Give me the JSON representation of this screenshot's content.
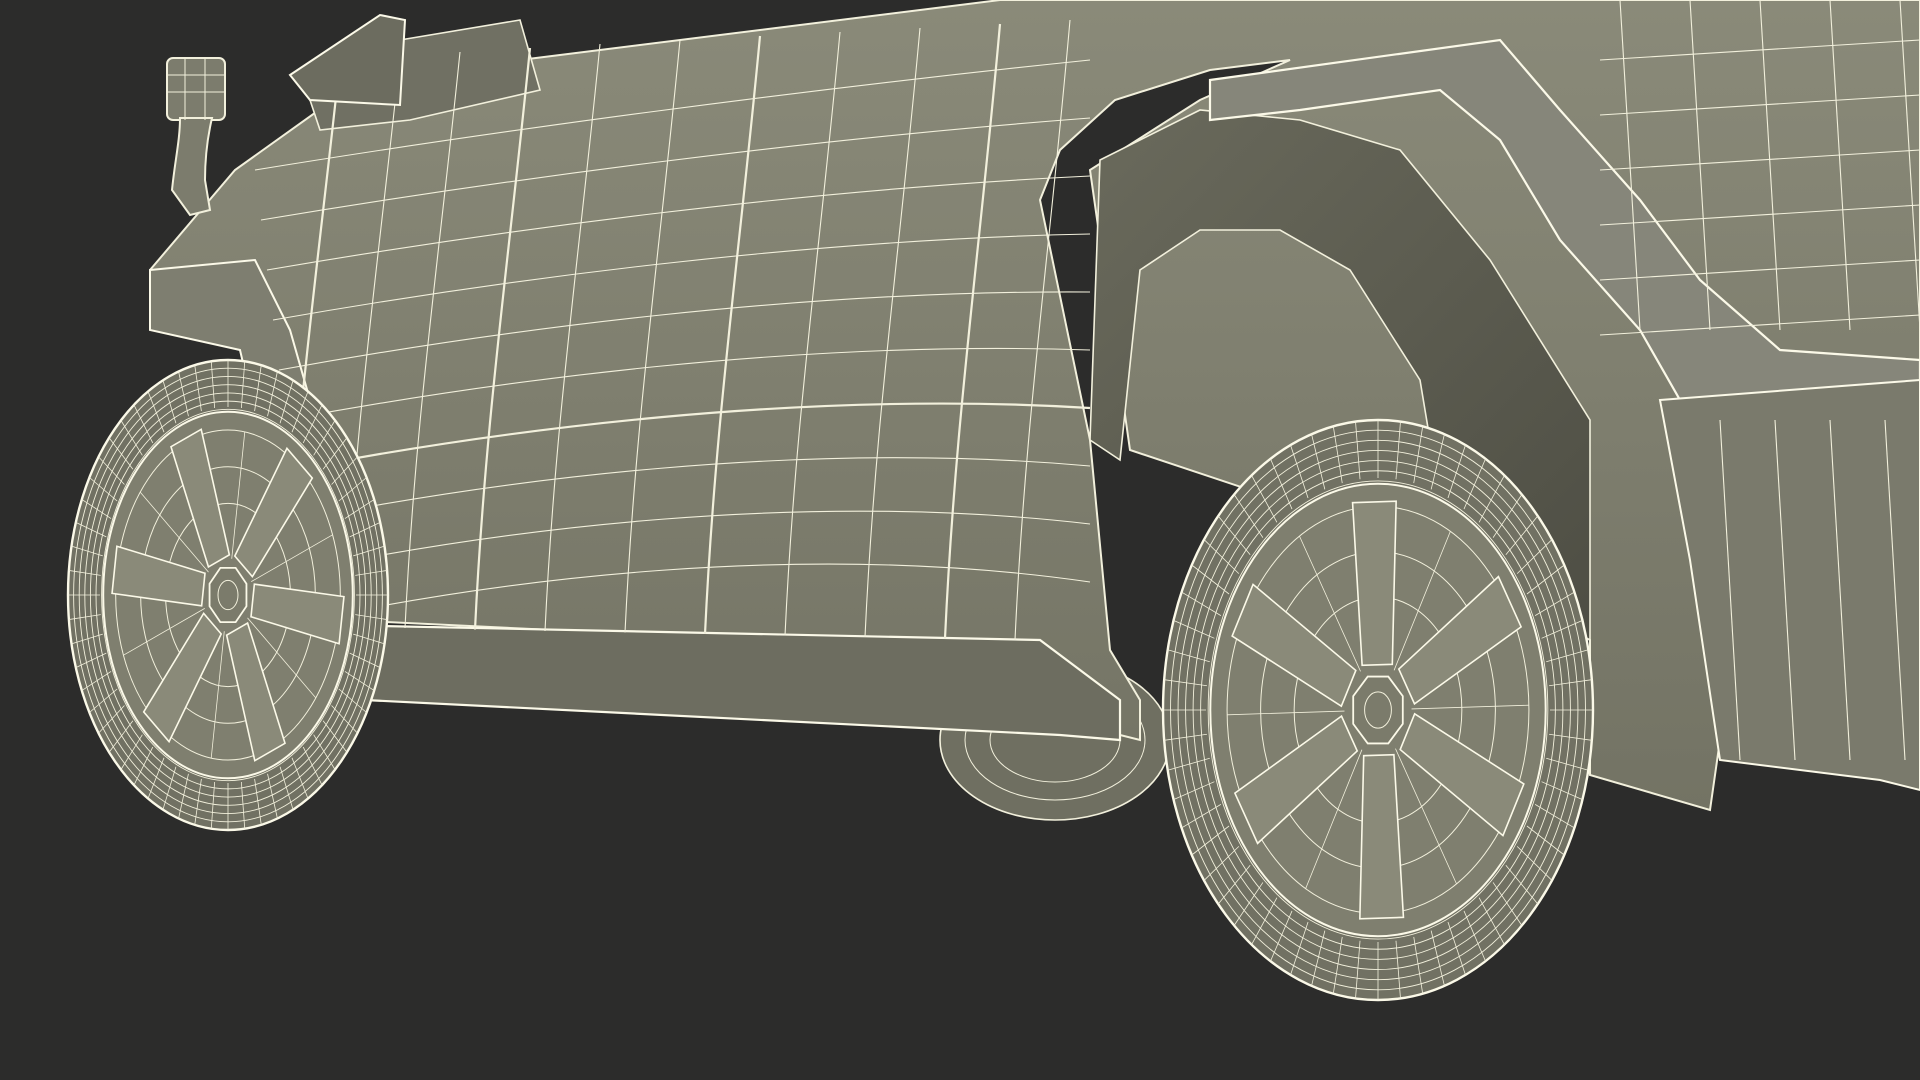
{
  "scene": {
    "subject": "vehicle-3d-wireframe-render",
    "render_mode": "wireframe-over-shaded",
    "colors": {
      "background": "#2c2c2b",
      "body_fill": "#7b7b6b",
      "body_fill_dark": "#5f5f52",
      "body_fill_light": "#8a8a79",
      "tire_fill": "#717163",
      "rim_fill": "#7f7f6f",
      "wire": "#f2f0dc",
      "wire_strong": "#fbf9e8"
    },
    "icons": [
      "front-wheel-icon",
      "rear-wheel-icon",
      "side-mirror-icon"
    ]
  }
}
